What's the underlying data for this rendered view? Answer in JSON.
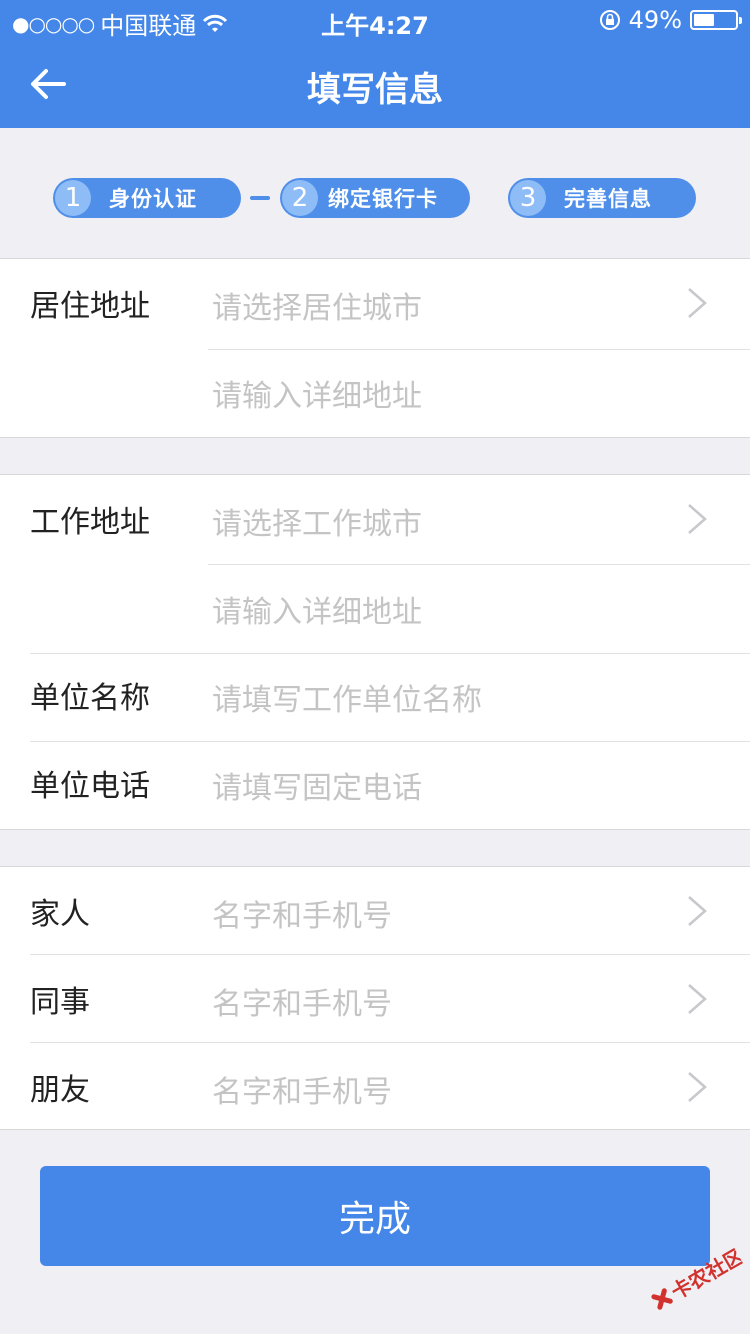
{
  "status_bar": {
    "signal": "●○○○○",
    "carrier": "中国联通",
    "time": "上午4:27",
    "battery_text": "49%",
    "battery_level": 0.49
  },
  "nav": {
    "title": "填写信息"
  },
  "steps": [
    {
      "num": "1",
      "label": "身份认证"
    },
    {
      "num": "2",
      "label": "绑定银行卡"
    },
    {
      "num": "3",
      "label": "完善信息"
    }
  ],
  "residence": {
    "label": "居住地址",
    "city_placeholder": "请选择居住城市",
    "detail_placeholder": "请输入详细地址"
  },
  "work": {
    "label": "工作地址",
    "city_placeholder": "请选择工作城市",
    "detail_placeholder": "请输入详细地址",
    "company_label": "单位名称",
    "company_placeholder": "请填写工作单位名称",
    "phone_label": "单位电话",
    "phone_placeholder": "请填写固定电话"
  },
  "contacts": [
    {
      "label": "家人",
      "placeholder": "名字和手机号"
    },
    {
      "label": "同事",
      "placeholder": "名字和手机号"
    },
    {
      "label": "朋友",
      "placeholder": "名字和手机号"
    }
  ],
  "done_button": "完成",
  "watermark_text": "卡农社区",
  "colors": {
    "primary": "#4487e9",
    "background": "#efeff4",
    "placeholder": "#c4c4c4"
  }
}
